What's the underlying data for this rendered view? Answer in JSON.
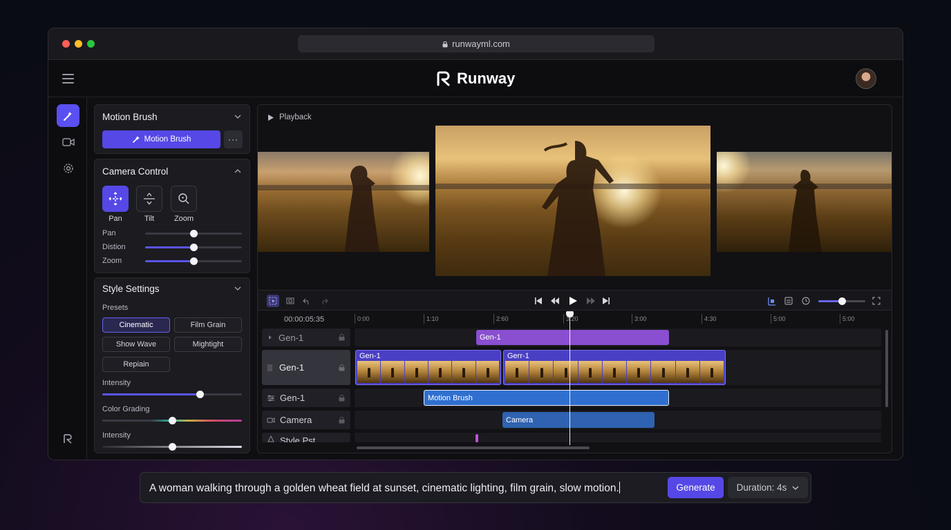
{
  "browser": {
    "url": "runwayml.com",
    "traffic_lights": [
      "#ff5f57",
      "#febc2e",
      "#28c840"
    ]
  },
  "header": {
    "brand": "Runway",
    "menu_icon": "hamburger-icon",
    "avatar_icon": "user-avatar"
  },
  "rail": {
    "items": [
      {
        "icon": "magic-brush-icon",
        "active": true
      },
      {
        "icon": "video-camera-icon",
        "active": false
      },
      {
        "icon": "gear-icon",
        "active": false
      }
    ],
    "bottom_icon": "runway-logo-icon"
  },
  "motion_brush": {
    "title": "Motion Brush",
    "button": "Motion Brush",
    "more": "···"
  },
  "camera_control": {
    "title": "Camera Control",
    "modes": [
      {
        "label": "Pan",
        "icon": "move-arrows-icon",
        "active": true
      },
      {
        "label": "Tilt",
        "icon": "tilt-arrows-icon",
        "active": false
      },
      {
        "label": "Zoom",
        "icon": "zoom-icon",
        "active": false
      }
    ],
    "sliders": [
      {
        "label": "Pan",
        "value": 0.5
      },
      {
        "label": "Distion",
        "value": 0.5
      },
      {
        "label": "Zoom",
        "value": 0.5
      }
    ]
  },
  "style_settings": {
    "title": "Style Settings",
    "presets_label": "Presets",
    "presets": [
      "Cinematic",
      "Film Grain",
      "Show Wave",
      "Mightight",
      "Repiain"
    ],
    "active_preset": "Cinematic",
    "intensity_label": "Intensity",
    "intensity_value": 0.7,
    "color_grading_label": "Color Grading",
    "color_grading_value": 0.5,
    "intensity2_label": "Intensity",
    "intensity2_value": 0.5
  },
  "viewer": {
    "playback_label": "Playback",
    "volume_value": 0.5
  },
  "timeline": {
    "timecode": "00:00:05:35",
    "ticks": [
      "0:00",
      "1:10",
      "2:60",
      "3:20",
      "3:00",
      "4:30",
      "5:00",
      "5:00"
    ],
    "tracks": [
      "Gen-1",
      "Gen-1",
      "Gen-1",
      "Camera",
      "Style Pst"
    ],
    "clips": {
      "gen1_top": "Gen-1",
      "video_a": "Gen-1",
      "video_b": "Gerr-1",
      "motion_brush": "Motion Brush",
      "camera": "Camera"
    }
  },
  "prompt": {
    "text": "A woman walking through a golden wheat field at sunset, cinematic lighting, film grain, slow motion.",
    "generate": "Generate",
    "duration": "Duration: 4s"
  },
  "colors": {
    "accent": "#5548e6",
    "clip_purple": "#8a4fd0",
    "clip_blue": "#2f6fcf"
  }
}
